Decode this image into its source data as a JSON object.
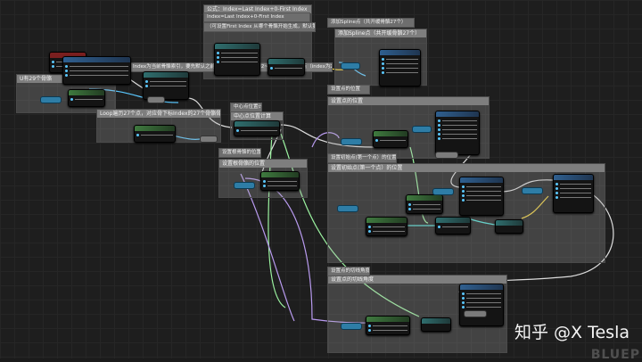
{
  "labels": {
    "formula": "公式：Index=Last Index+0-First Index",
    "formula2": "Index=Last Index+0-First Index",
    "first_index_note": "（可设置First Index 从哪个骨骼开始生成，默认第0）",
    "spawn_cube": "添加Spline点（共开缓骨骼27个）",
    "u_note": "U有29个骨骼",
    "index_note": "Index为当前骨骼索引，要先默认之前骨骼全是0，index为2~26需要加2-1个点（index为2~26加Idx=2-2=27个点）",
    "loop_note": "Loop遍历27个点，对应骨下标Index的27个骨骼骨",
    "mid_note": "中心点位置计算",
    "set_pos": "设置点的位置",
    "root_note": "设置根骨骼的位置",
    "set_rot": "设置初始点(第一个点）的位置",
    "set_scale": "设置点的切线角度",
    "watermark": "知乎 @X Tesla",
    "engine": "BLUEP"
  }
}
